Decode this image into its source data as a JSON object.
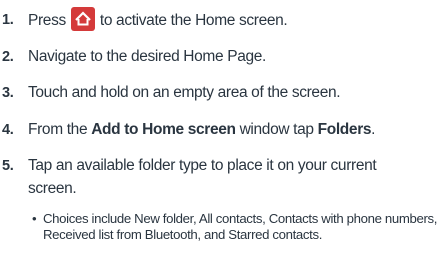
{
  "steps": [
    {
      "num": "1.",
      "text_before": "Press",
      "icon": "home-key-icon",
      "text_after": "to activate the Home screen."
    },
    {
      "num": "2.",
      "text": "Navigate to the desired Home Page."
    },
    {
      "num": "3.",
      "text": "Touch and hold on an empty area of the screen."
    },
    {
      "num": "4.",
      "text_before": "From the",
      "bold1": "Add to Home screen",
      "text_mid": "window tap",
      "bold2": "Folders",
      "text_after": "."
    },
    {
      "num": "5.",
      "line1": "Tap an available folder type to place it on your current",
      "line2": "screen."
    }
  ],
  "bullet": {
    "symbol": "•",
    "text": "Choices include New folder, All contacts, Contacts with phone numbers, Received list from Bluetooth, and Starred contacts."
  },
  "colors": {
    "text": "#2a3540",
    "home_key_bg": "#d43a3a",
    "home_key_glyph": "#ffffff"
  }
}
